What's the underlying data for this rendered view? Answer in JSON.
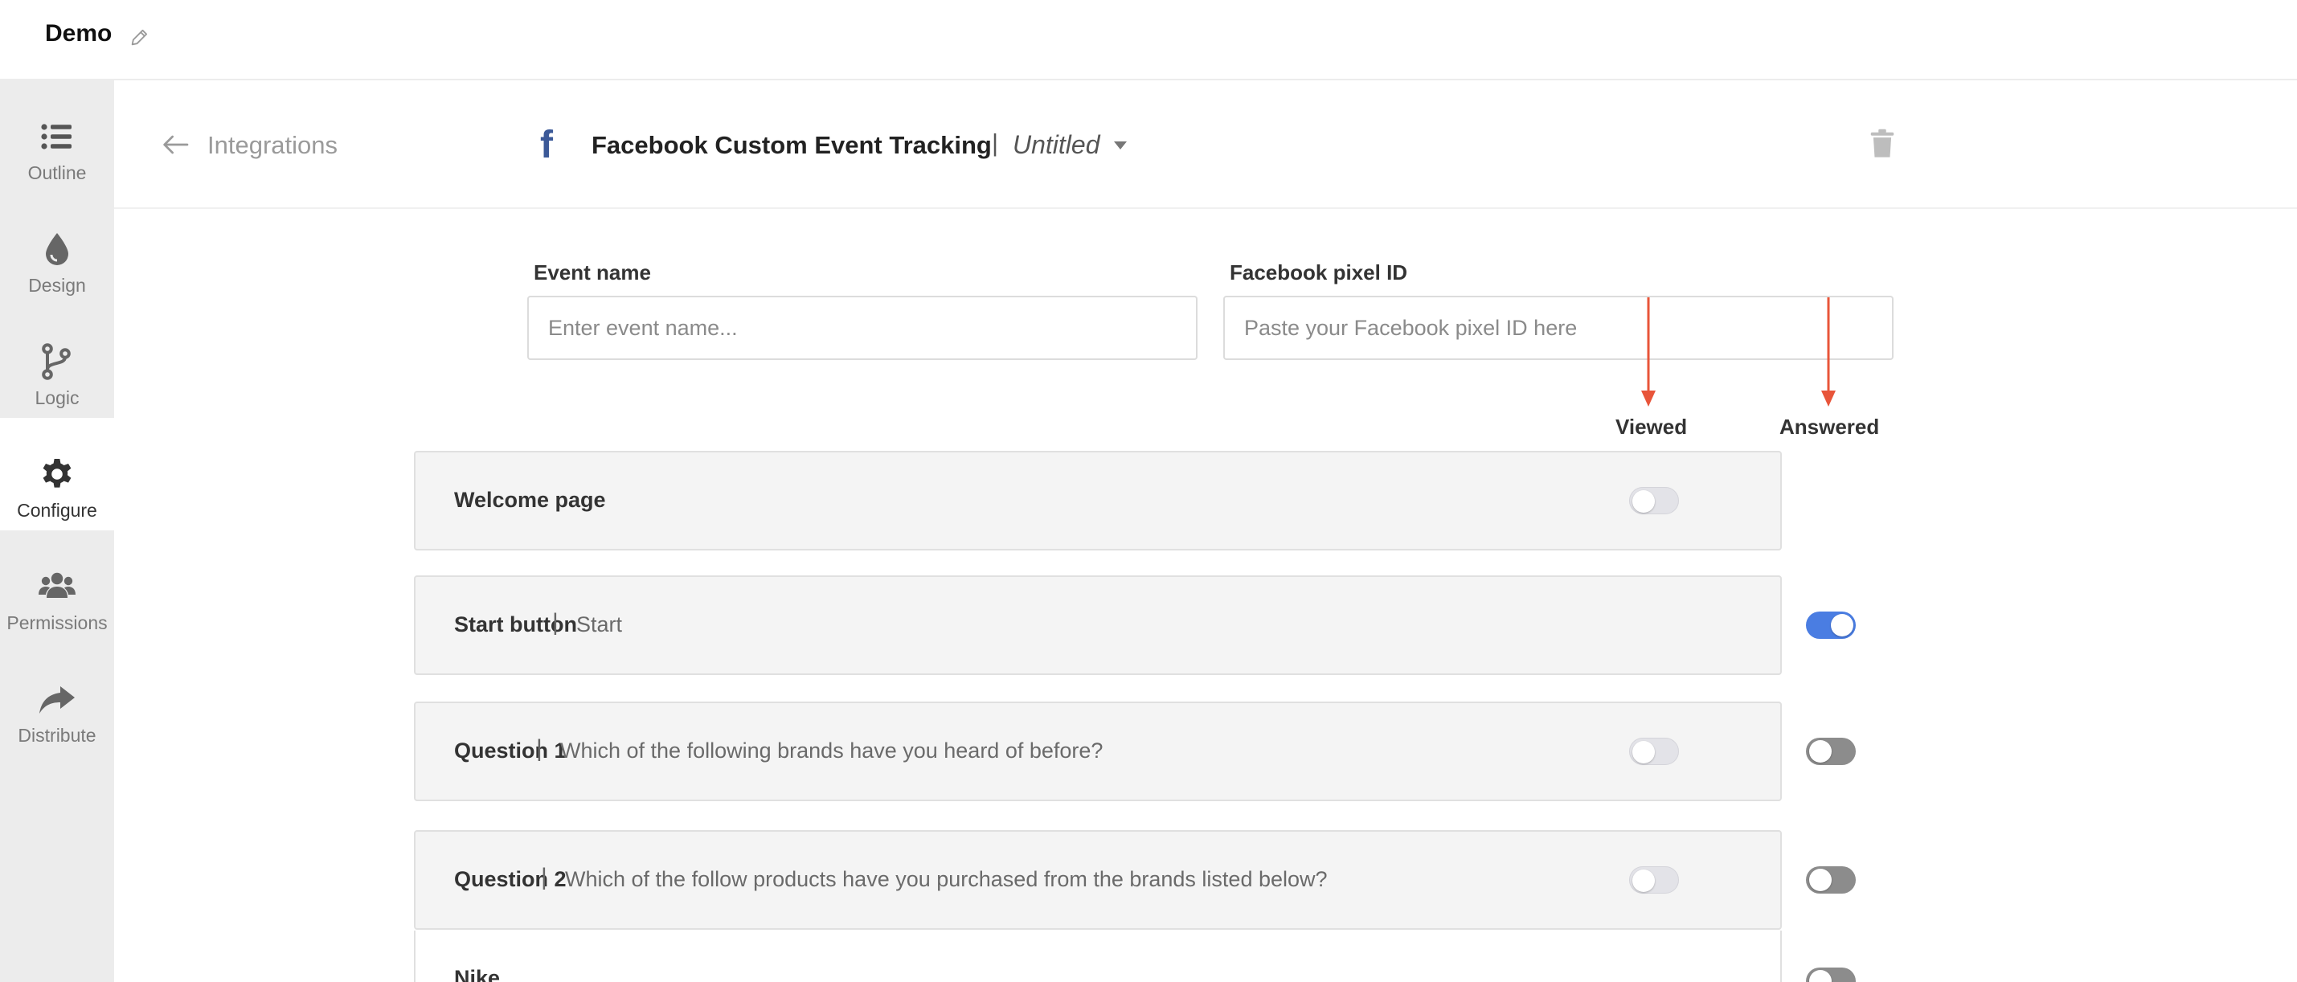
{
  "app": {
    "title": "Demo"
  },
  "sidebar": {
    "items": [
      {
        "label": "Outline",
        "icon": "list-icon"
      },
      {
        "label": "Design",
        "icon": "droplet-icon"
      },
      {
        "label": "Logic",
        "icon": "branch-icon"
      },
      {
        "label": "Configure",
        "icon": "gear-icon",
        "active": true
      },
      {
        "label": "Permissions",
        "icon": "users-icon"
      },
      {
        "label": "Distribute",
        "icon": "share-icon"
      }
    ]
  },
  "header": {
    "back_label": "Integrations",
    "integration_title": "Facebook Custom Event Tracking",
    "separator": "|",
    "subtitle": "Untitled",
    "logo_glyph": "f"
  },
  "form": {
    "event_name": {
      "label": "Event name",
      "placeholder": "Enter event name...",
      "value": ""
    },
    "pixel_id": {
      "label": "Facebook pixel ID",
      "placeholder": "Paste your Facebook pixel ID here",
      "value": ""
    }
  },
  "columns": {
    "viewed": "Viewed",
    "answered": "Answered"
  },
  "rows": [
    {
      "title": "Welcome page",
      "desc": "",
      "viewed": "off",
      "answered": null
    },
    {
      "title": "Start button",
      "desc": "Start",
      "viewed": null,
      "answered": "on"
    },
    {
      "title": "Question 1",
      "desc": "Which of the following brands have you heard of before?",
      "viewed": "off",
      "answered": "off"
    },
    {
      "title": "Question 2",
      "desc": "Which of the follow products have you purchased from the brands listed below?",
      "viewed": "off",
      "answered": "off"
    }
  ],
  "subrows": [
    {
      "title": "Nike"
    }
  ],
  "colors": {
    "accent": "#4a7de2",
    "facebook": "#3b5998",
    "annotation_arrow": "#e8553a"
  }
}
